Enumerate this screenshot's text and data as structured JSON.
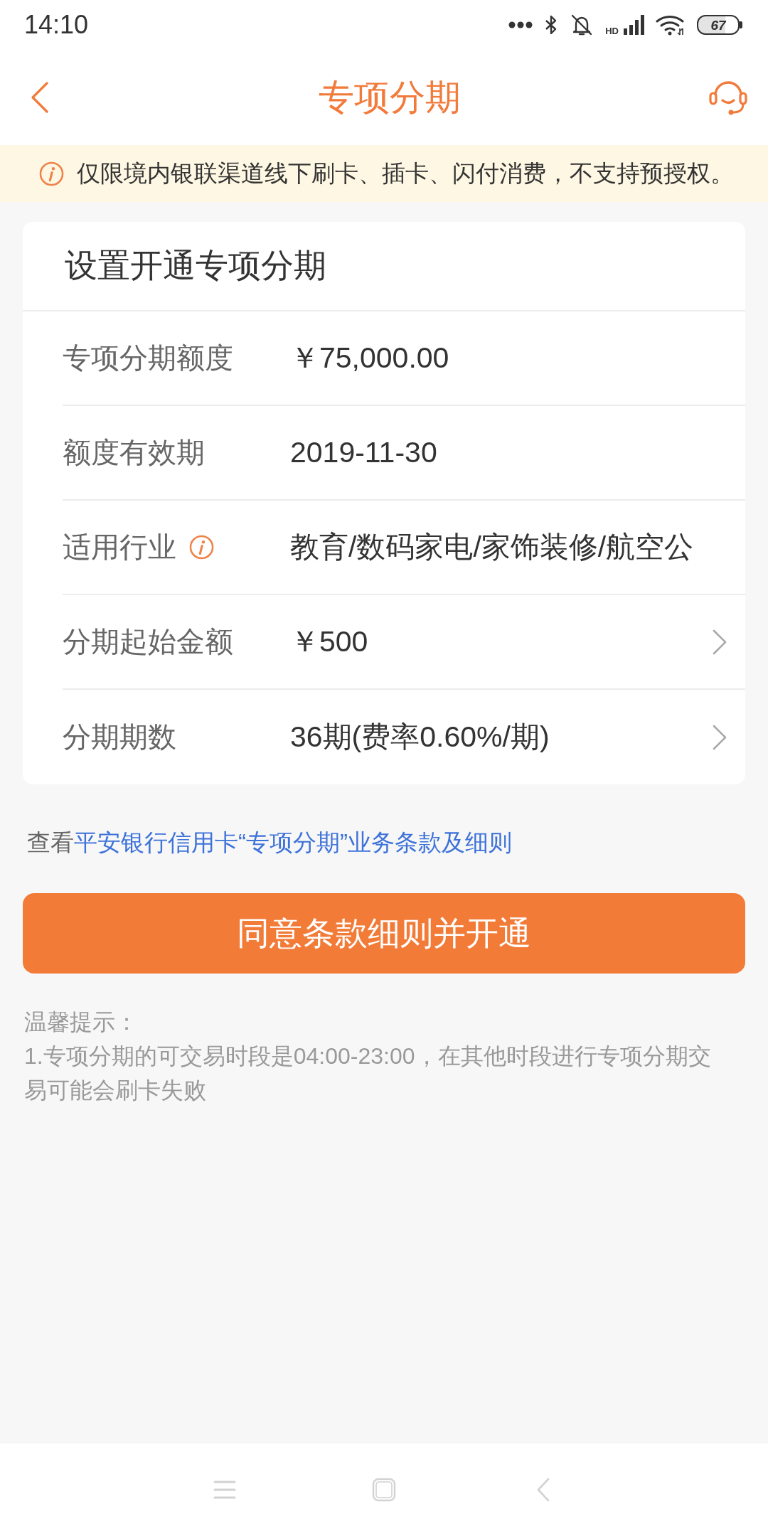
{
  "status_bar": {
    "time": "14:10",
    "network_type": "HD",
    "battery": "67"
  },
  "header": {
    "title": "专项分期"
  },
  "notice": {
    "text": "仅限境内银联渠道线下刷卡、插卡、闪付消费，不支持预授权。"
  },
  "card": {
    "title": "设置开通专项分期",
    "rows": [
      {
        "label": "专项分期额度",
        "value": "￥75,000.00",
        "info": false,
        "chevron": false
      },
      {
        "label": "额度有效期",
        "value": "2019-11-30",
        "info": false,
        "chevron": false
      },
      {
        "label": "适用行业",
        "value": "教育/数码家电/家饰装修/航空公",
        "info": true,
        "chevron": false
      },
      {
        "label": "分期起始金额",
        "value": "￥500",
        "info": false,
        "chevron": true
      },
      {
        "label": "分期期数",
        "value": "36期(费率0.60%/期)",
        "info": false,
        "chevron": true
      }
    ]
  },
  "terms": {
    "prefix": "查看",
    "link": "平安银行信用卡“专项分期”业务条款及细则"
  },
  "agree_button": {
    "label": "同意条款细则并开通"
  },
  "tips": {
    "title": "温馨提示：",
    "lines": [
      "1.专项分期的可交易时段是04:00-23:00，在其他时段进行专项分期交易可能会刷卡失败"
    ]
  }
}
